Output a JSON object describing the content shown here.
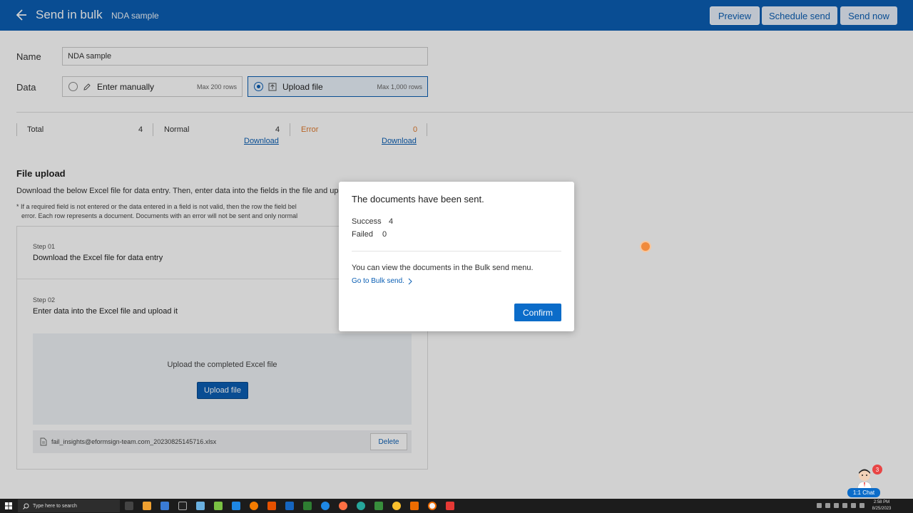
{
  "header": {
    "title": "Send in bulk",
    "subtitle": "NDA sample",
    "buttons": {
      "preview": "Preview",
      "schedule": "Schedule send",
      "send_now": "Send now"
    }
  },
  "form": {
    "name_label": "Name",
    "name_value": "NDA sample",
    "data_label": "Data",
    "options": [
      {
        "label": "Enter manually",
        "max": "Max 200 rows",
        "selected": false,
        "icon": "pencil-icon"
      },
      {
        "label": "Upload file",
        "max": "Max 1,000 rows",
        "selected": true,
        "icon": "upload-icon"
      }
    ]
  },
  "stats": {
    "total_label": "Total",
    "total_value": "4",
    "normal_label": "Normal",
    "normal_value": "4",
    "error_label": "Error",
    "error_value": "0",
    "download": "Download",
    "error_color": "#e07b2e"
  },
  "file_upload": {
    "title": "File upload",
    "description": "Download the below Excel file for data entry. Then, enter data into the fields in the file and up",
    "note_line1": "* If a required field is not entered or the data entered in a field is not valid, then the row the field bel",
    "note_line2": "error. Each row represents a document. Documents with an error will not be sent and only normal",
    "step1_small": "Step 01",
    "step1_main": "Download the Excel file for data entry",
    "step2_small": "Step 02",
    "step2_main": "Enter data into the Excel file and upload it",
    "upload_text": "Upload the completed Excel file",
    "upload_button": "Upload file",
    "file_name": "fail_insights@eformsign-team.com_20230825145716.xlsx",
    "delete_button": "Delete"
  },
  "modal": {
    "title": "The documents have been sent.",
    "success_label": "Success",
    "success_value": "4",
    "failed_label": "Failed",
    "failed_value": "0",
    "text": "You can view the documents in the Bulk send menu.",
    "link": "Go to Bulk send.",
    "confirm": "Confirm"
  },
  "chat": {
    "badge": "3",
    "label": "1:1 Chat"
  },
  "taskbar": {
    "search_placeholder": "Type here to search",
    "time": "2:58 PM",
    "date": "8/25/2023"
  },
  "colors": {
    "brand": "#0b5fb4",
    "confirm": "#0b6cc9"
  }
}
